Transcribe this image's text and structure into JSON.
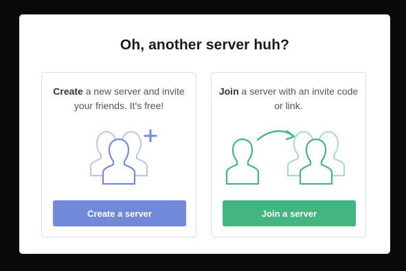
{
  "modal": {
    "title": "Oh, another server huh?"
  },
  "create_card": {
    "emphasis": "Create",
    "description_rest": " a new server and invite your friends. It's free!",
    "button_label": "Create a server",
    "icon": "users-plus-icon",
    "accent_color": "#7289da"
  },
  "join_card": {
    "emphasis": "Join",
    "description_rest": " a server with an invite code or link.",
    "button_label": "Join a server",
    "icon": "user-join-group-icon",
    "accent_color": "#43b581"
  }
}
